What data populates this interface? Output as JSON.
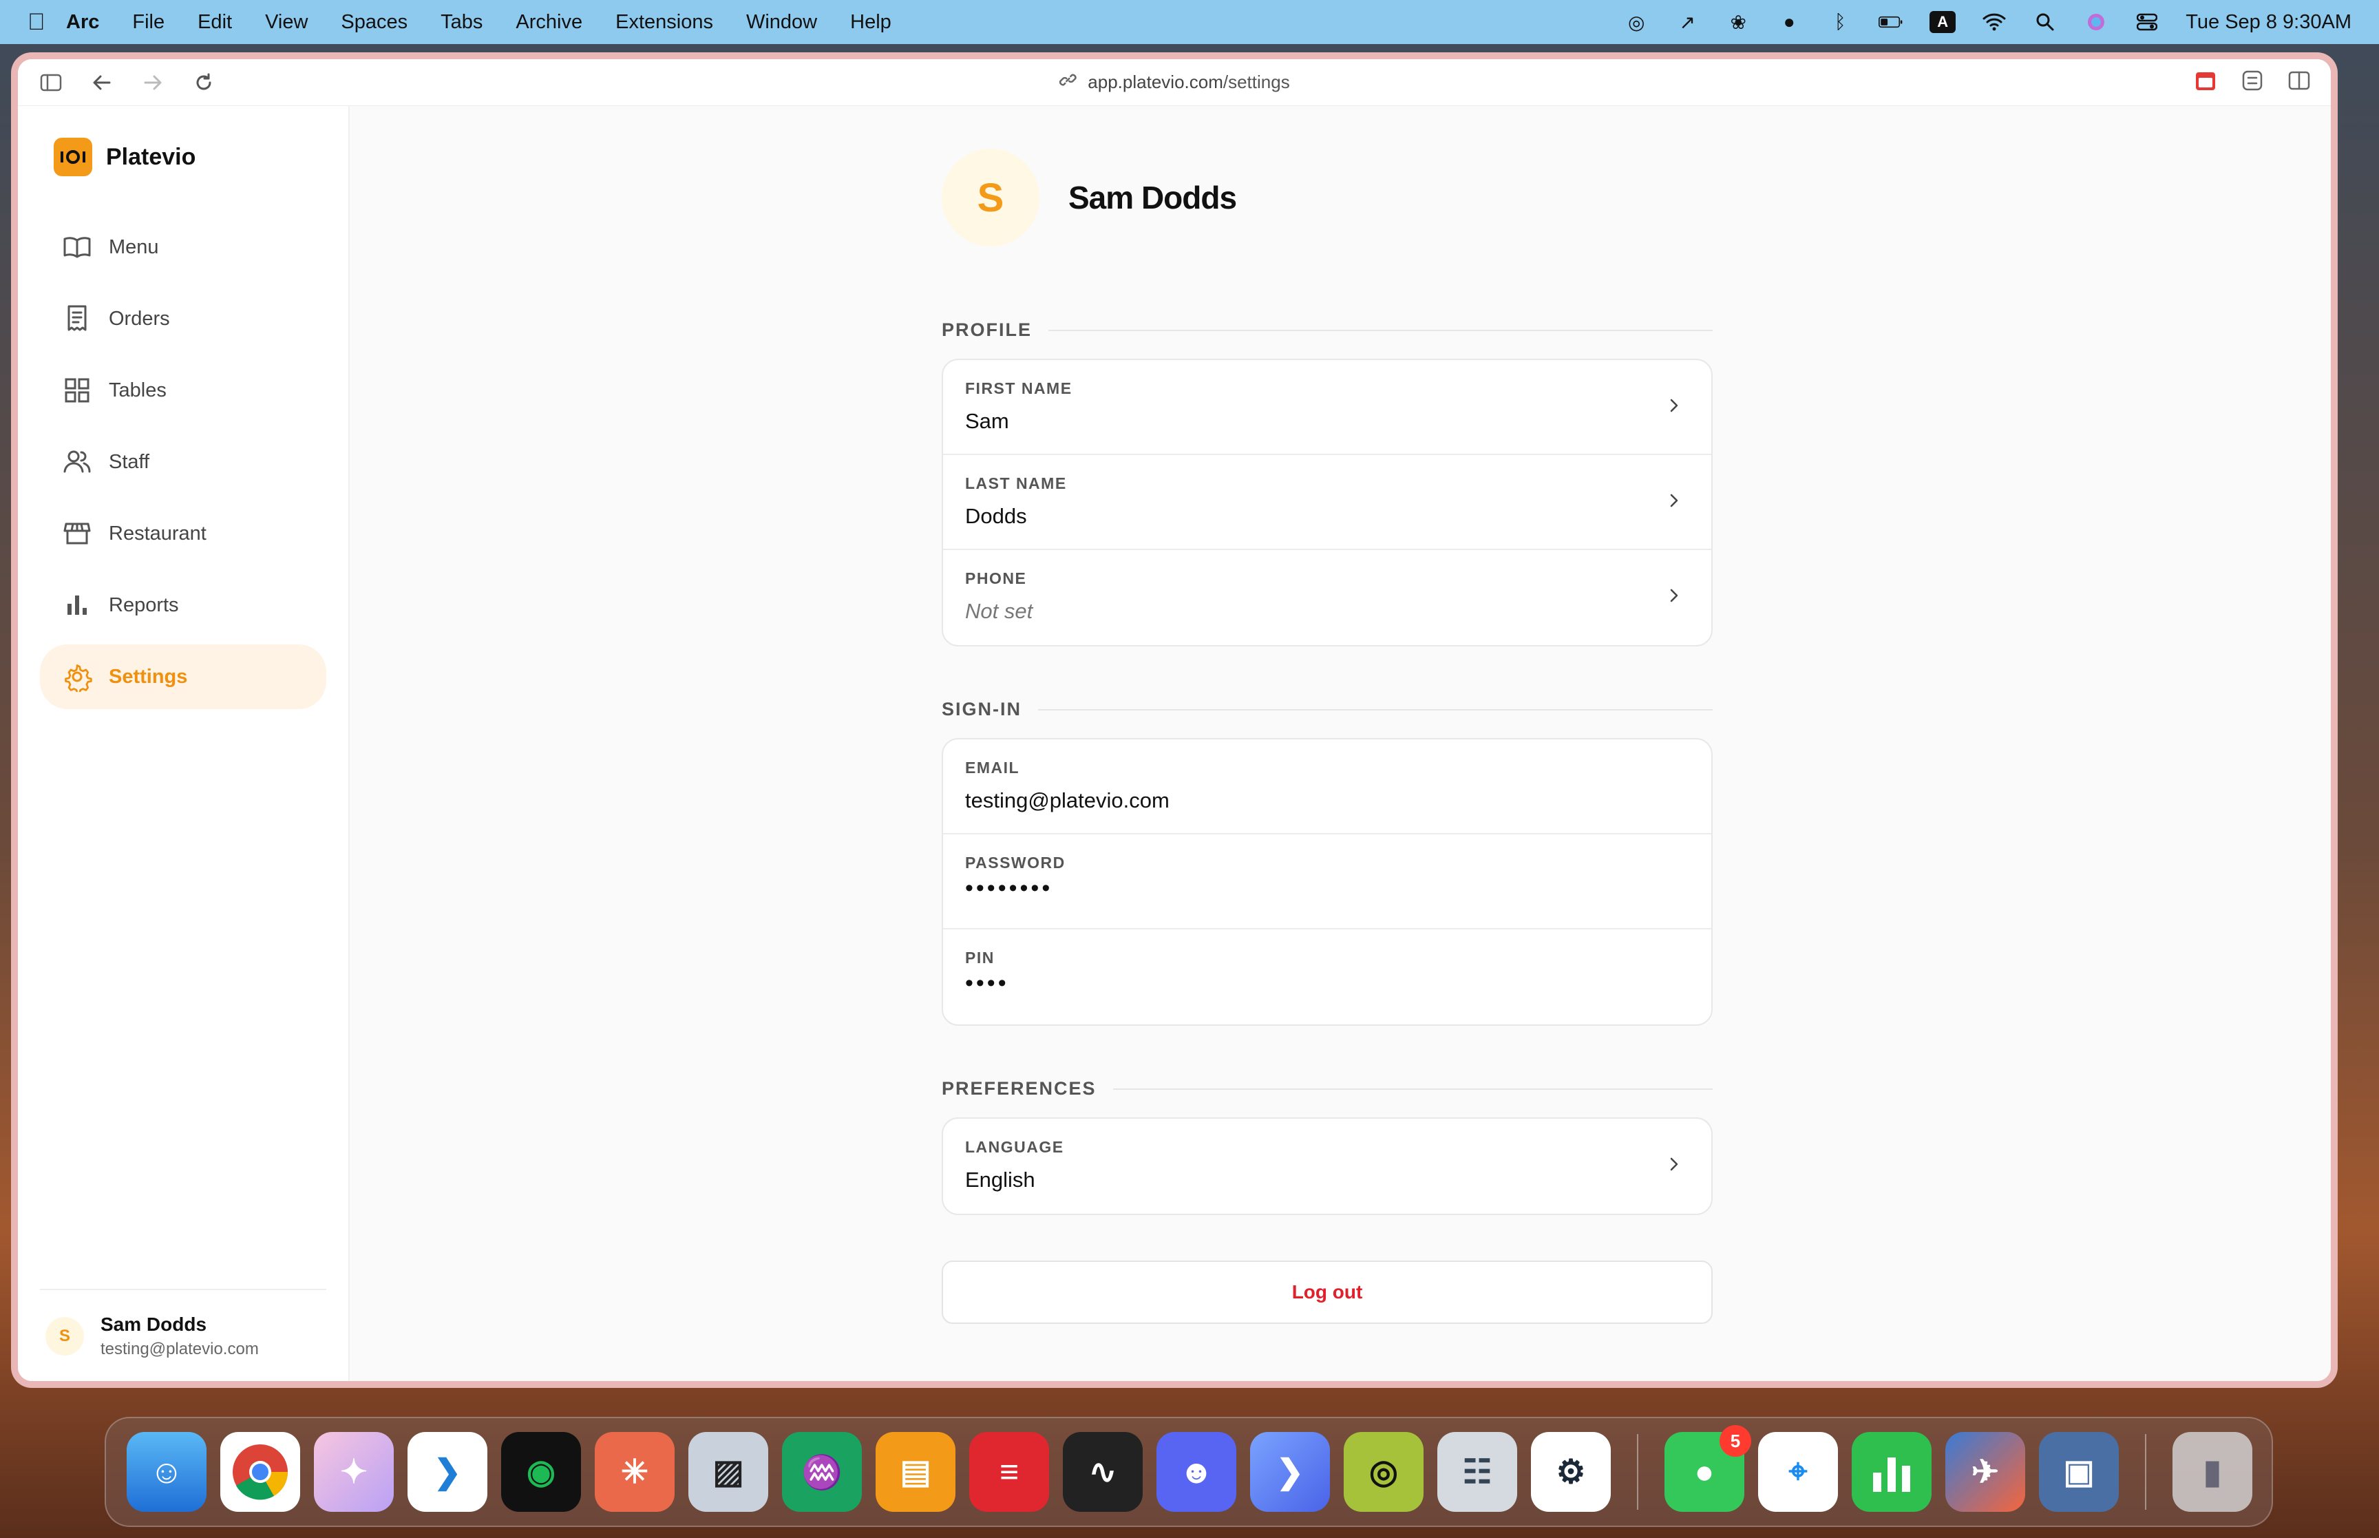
{
  "menubar": {
    "app": "Arc",
    "items": [
      "File",
      "Edit",
      "View",
      "Spaces",
      "Tabs",
      "Archive",
      "Extensions",
      "Window",
      "Help"
    ],
    "clock": "Tue Sep 8  9:30AM",
    "input_badge": "A"
  },
  "browser": {
    "url_host": "app.platevio.com",
    "url_path": "/settings"
  },
  "sidebar": {
    "brand": "Platevio",
    "items": [
      {
        "label": "Menu",
        "icon": "book-icon"
      },
      {
        "label": "Orders",
        "icon": "receipt-icon"
      },
      {
        "label": "Tables",
        "icon": "grid-icon"
      },
      {
        "label": "Staff",
        "icon": "users-icon"
      },
      {
        "label": "Restaurant",
        "icon": "store-icon"
      },
      {
        "label": "Reports",
        "icon": "bar-chart-icon"
      },
      {
        "label": "Settings",
        "icon": "gear-icon",
        "active": true
      }
    ],
    "user": {
      "initial": "S",
      "name": "Sam Dodds",
      "email": "testing@platevio.com"
    }
  },
  "header": {
    "initial": "S",
    "name": "Sam Dodds"
  },
  "sections": {
    "profile": {
      "title": "PROFILE",
      "rows": [
        {
          "label": "FIRST NAME",
          "value": "Sam"
        },
        {
          "label": "LAST NAME",
          "value": "Dodds"
        },
        {
          "label": "PHONE",
          "value": "Not set"
        }
      ]
    },
    "signin": {
      "title": "SIGN-IN",
      "rows": [
        {
          "label": "EMAIL",
          "value": "testing@platevio.com"
        },
        {
          "label": "PASSWORD",
          "value": "••••••••"
        },
        {
          "label": "PIN",
          "value": "••••"
        }
      ]
    },
    "preferences": {
      "title": "PREFERENCES",
      "rows": [
        {
          "label": "LANGUAGE",
          "value": "English"
        }
      ]
    }
  },
  "actions": {
    "logout": "Log out"
  },
  "dock": {
    "messages_badge": "5"
  },
  "colors": {
    "accent": "#f39a18",
    "danger": "#e0202a",
    "menubar": "#8ec9ee"
  }
}
